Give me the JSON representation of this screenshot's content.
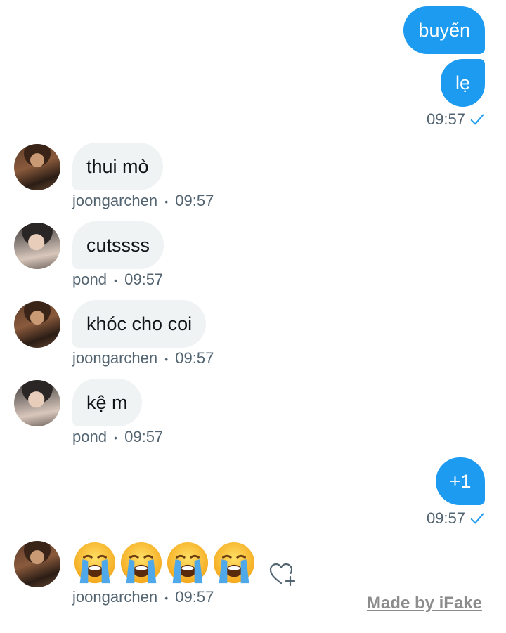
{
  "messages": {
    "out1": {
      "text": "buyến"
    },
    "out2": {
      "text": "lẹ"
    },
    "out_meta1": {
      "time": "09:57"
    },
    "in1": {
      "text": "thui mò",
      "sender": "joongarchen",
      "sep": "•",
      "time": "09:57"
    },
    "in2": {
      "text": "cutssss",
      "sender": "pond",
      "sep": "•",
      "time": "09:57"
    },
    "in3": {
      "text": "khóc cho coi",
      "sender": "joongarchen",
      "sep": "•",
      "time": "09:57"
    },
    "in4": {
      "text": "kệ m",
      "sender": "pond",
      "sep": "•",
      "time": "09:57"
    },
    "out3": {
      "text": "+1"
    },
    "out_meta2": {
      "time": "09:57"
    },
    "in5": {
      "emoji": [
        "crying-face",
        "crying-face",
        "crying-face",
        "crying-face"
      ],
      "sender": "joongarchen",
      "sep": "•",
      "time": "09:57"
    }
  },
  "watermark": "Made by iFake",
  "colors": {
    "accent": "#1d9bf0",
    "incoming_bubble": "#eff3f4",
    "meta": "#536471"
  },
  "icons": {
    "check": "check-icon",
    "reaction": "heart-add-icon"
  }
}
